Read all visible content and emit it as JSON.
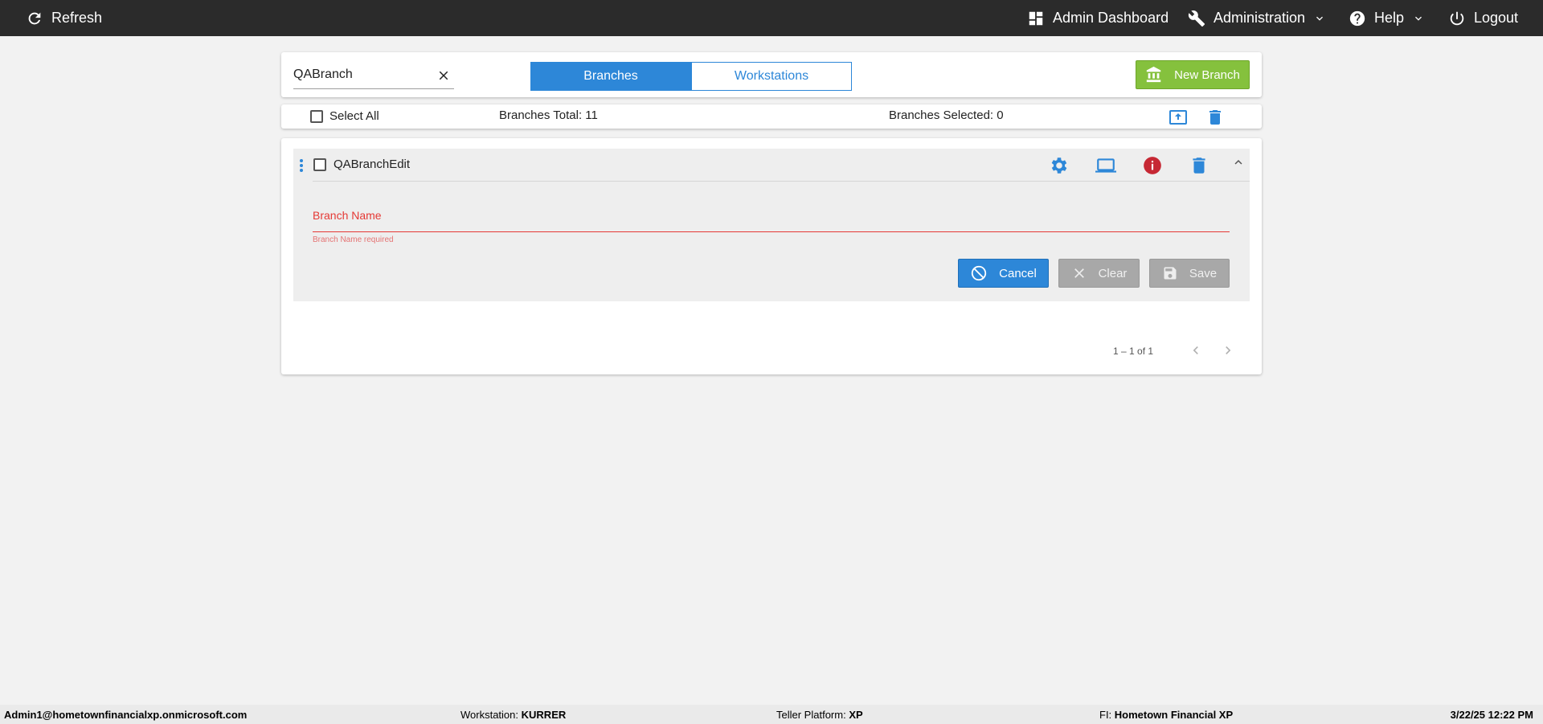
{
  "topbar": {
    "refresh_label": "Refresh",
    "admin_dashboard_label": "Admin Dashboard",
    "administration_label": "Administration",
    "help_label": "Help",
    "logout_label": "Logout",
    "background": "#2b2b2b"
  },
  "toolbar": {
    "search_value": "QABranch",
    "tabs": [
      {
        "label": "Branches",
        "active": true
      },
      {
        "label": "Workstations",
        "active": false
      }
    ],
    "new_branch_label": "New Branch"
  },
  "summary": {
    "select_all_label": "Select All",
    "branches_total": "Branches Total: 11",
    "branches_selected": "Branches Selected: 0"
  },
  "branch_item": {
    "name": "QABranchEdit",
    "field_label": "Branch Name",
    "field_value": "",
    "field_error": "Branch Name required",
    "cancel_label": "Cancel",
    "clear_label": "Clear",
    "save_label": "Save"
  },
  "pagination": {
    "range_label": "1 – 1 of 1"
  },
  "footer": {
    "user": "Admin1@hometownfinancialxp.onmicrosoft.com",
    "workstation_label": "Workstation:",
    "workstation_value": "KURRER",
    "platform_label": "Teller Platform:",
    "platform_value": "XP",
    "fi_label": "FI:",
    "fi_value": "Hometown Financial XP",
    "datetime": "3/22/25 12:22 PM"
  },
  "colors": {
    "accent_blue": "#2d87d8",
    "brand_green": "#85c13d",
    "error_red": "#e53935",
    "info_red": "#c62834"
  }
}
